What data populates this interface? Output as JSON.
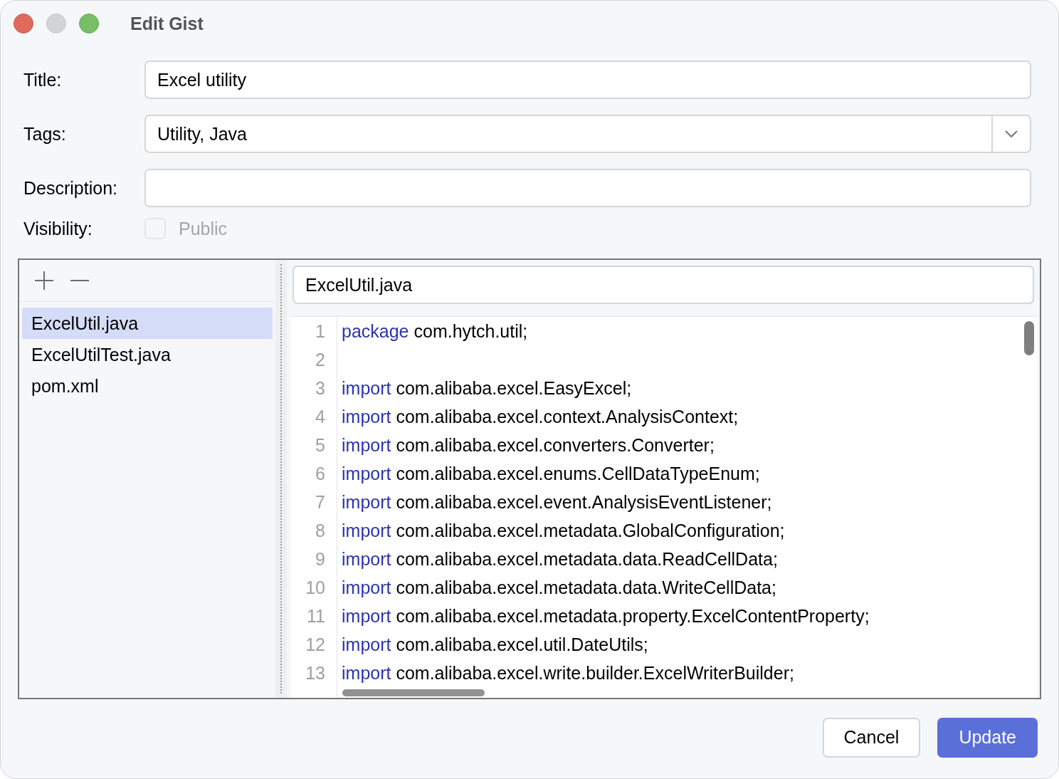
{
  "window": {
    "title": "Edit Gist"
  },
  "form": [
    {
      "label": "Title:",
      "kind": "text",
      "value": "Excel utility"
    },
    {
      "label": "Tags:",
      "kind": "combo",
      "value": "Utility, Java"
    },
    {
      "label": "Description:",
      "kind": "text"
    }
  ],
  "visibility": {
    "label": "Visibility:",
    "option": "Public",
    "checked": false,
    "disabled": true
  },
  "files": [
    {
      "name": "ExcelUtil.java",
      "selected": true
    },
    {
      "name": "ExcelUtilTest.java",
      "selected": false
    },
    {
      "name": "pom.xml",
      "selected": false
    }
  ],
  "editor": {
    "filename": "ExcelUtil.java",
    "lines": [
      {
        "number": "1",
        "keyword": "package",
        "code": " com.hytch.util;"
      },
      {
        "number": "2"
      },
      {
        "number": "3",
        "keyword": "import",
        "code": " com.alibaba.excel.EasyExcel;"
      },
      {
        "number": "4",
        "keyword": "import",
        "code": " com.alibaba.excel.context.AnalysisContext;"
      },
      {
        "number": "5",
        "keyword": "import",
        "code": " com.alibaba.excel.converters.Converter;"
      },
      {
        "number": "6",
        "keyword": "import",
        "code": " com.alibaba.excel.enums.CellDataTypeEnum;"
      },
      {
        "number": "7",
        "keyword": "import",
        "code": " com.alibaba.excel.event.AnalysisEventListener;"
      },
      {
        "number": "8",
        "keyword": "import",
        "code": " com.alibaba.excel.metadata.GlobalConfiguration;"
      },
      {
        "number": "9",
        "keyword": "import",
        "code": " com.alibaba.excel.metadata.data.ReadCellData;"
      },
      {
        "number": "10",
        "keyword": "import",
        "code": " com.alibaba.excel.metadata.data.WriteCellData;"
      },
      {
        "number": "11",
        "keyword": "import",
        "code": " com.alibaba.excel.metadata.property.ExcelContentProperty;"
      },
      {
        "number": "12",
        "keyword": "import",
        "code": " com.alibaba.excel.util.DateUtils;"
      },
      {
        "number": "13",
        "keyword": "import",
        "code": " com.alibaba.excel.write.builder.ExcelWriterBuilder;"
      }
    ]
  },
  "buttons": [
    {
      "label": "Cancel",
      "kind": "secondary"
    },
    {
      "label": "Update",
      "kind": "primary"
    }
  ]
}
